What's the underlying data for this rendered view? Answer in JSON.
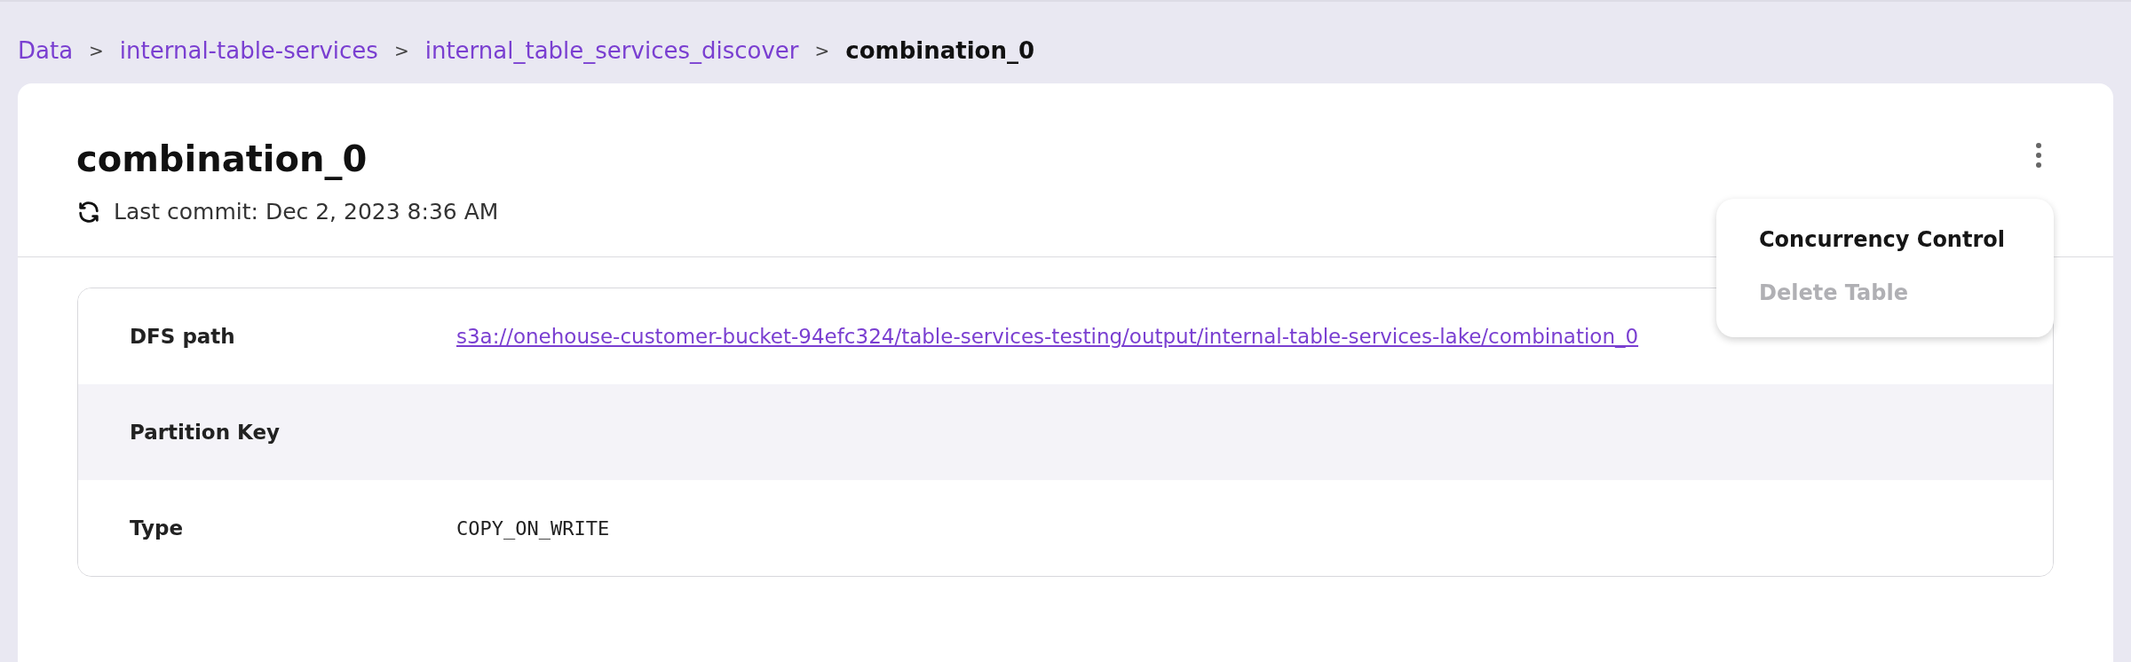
{
  "breadcrumb": [
    {
      "label": "Data",
      "kind": "link"
    },
    {
      "label": "internal-table-services",
      "kind": "link"
    },
    {
      "label": "internal_table_services_discover",
      "kind": "link"
    },
    {
      "label": "combination_0",
      "kind": "current"
    }
  ],
  "separator": ">",
  "header": {
    "title": "combination_0",
    "last_commit": "Last commit: Dec 2, 2023 8:36 AM"
  },
  "menu": {
    "open": true,
    "items": [
      {
        "label": "Concurrency Control",
        "disabled": false
      },
      {
        "label": "Delete Table",
        "disabled": true
      }
    ]
  },
  "details": [
    {
      "label": "DFS path",
      "value": "s3a://onehouse-customer-bucket-94efc324/table-services-testing/output/internal-table-services-lake/combination_0",
      "kind": "link",
      "highlighted": false
    },
    {
      "label": "Partition Key",
      "kind": "empty",
      "highlighted": true
    },
    {
      "label": "Type",
      "value": "COPY_ON_WRITE",
      "kind": "text",
      "highlighted": false
    }
  ]
}
